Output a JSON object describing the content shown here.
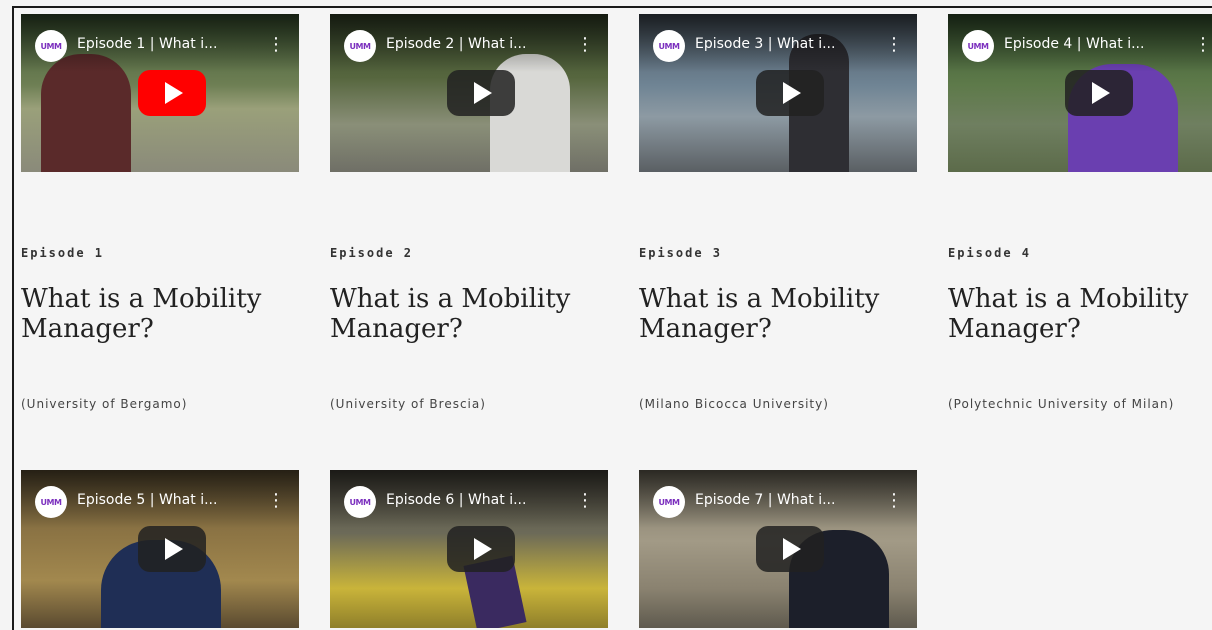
{
  "videos": [
    {
      "video_title": "Episode 1 | What i...",
      "episode": "Episode 1",
      "title": "What is a Mobility Manager?",
      "university": "(University of Bergamo)",
      "channel_logo": "UMM",
      "play_color": "#ff0000"
    },
    {
      "video_title": "Episode 2 | What i...",
      "episode": "Episode 2",
      "title": "What is a Mobility Manager?",
      "university": "(University of Brescia)",
      "channel_logo": "UMM",
      "play_color": "#212121"
    },
    {
      "video_title": "Episode 3 | What i...",
      "episode": "Episode 3",
      "title": "What is a Mobility Manager?",
      "university": "(Milano Bicocca University)",
      "channel_logo": "UMM",
      "play_color": "#212121"
    },
    {
      "video_title": "Episode 4 | What i...",
      "episode": "Episode 4",
      "title": "What is a Mobility Manager?",
      "university": "(Polytechnic University of Milan)",
      "channel_logo": "UMM",
      "play_color": "#212121"
    },
    {
      "video_title": "Episode 5 | What i...",
      "channel_logo": "UMM",
      "play_color": "#212121"
    },
    {
      "video_title": "Episode 6 | What i...",
      "channel_logo": "UMM",
      "play_color": "#212121"
    },
    {
      "video_title": "Episode 7 | What i...",
      "channel_logo": "UMM",
      "play_color": "#212121"
    }
  ],
  "icons": {
    "play": "play-icon",
    "more": "kebab-menu-icon",
    "channel": "channel-logo-icon"
  }
}
